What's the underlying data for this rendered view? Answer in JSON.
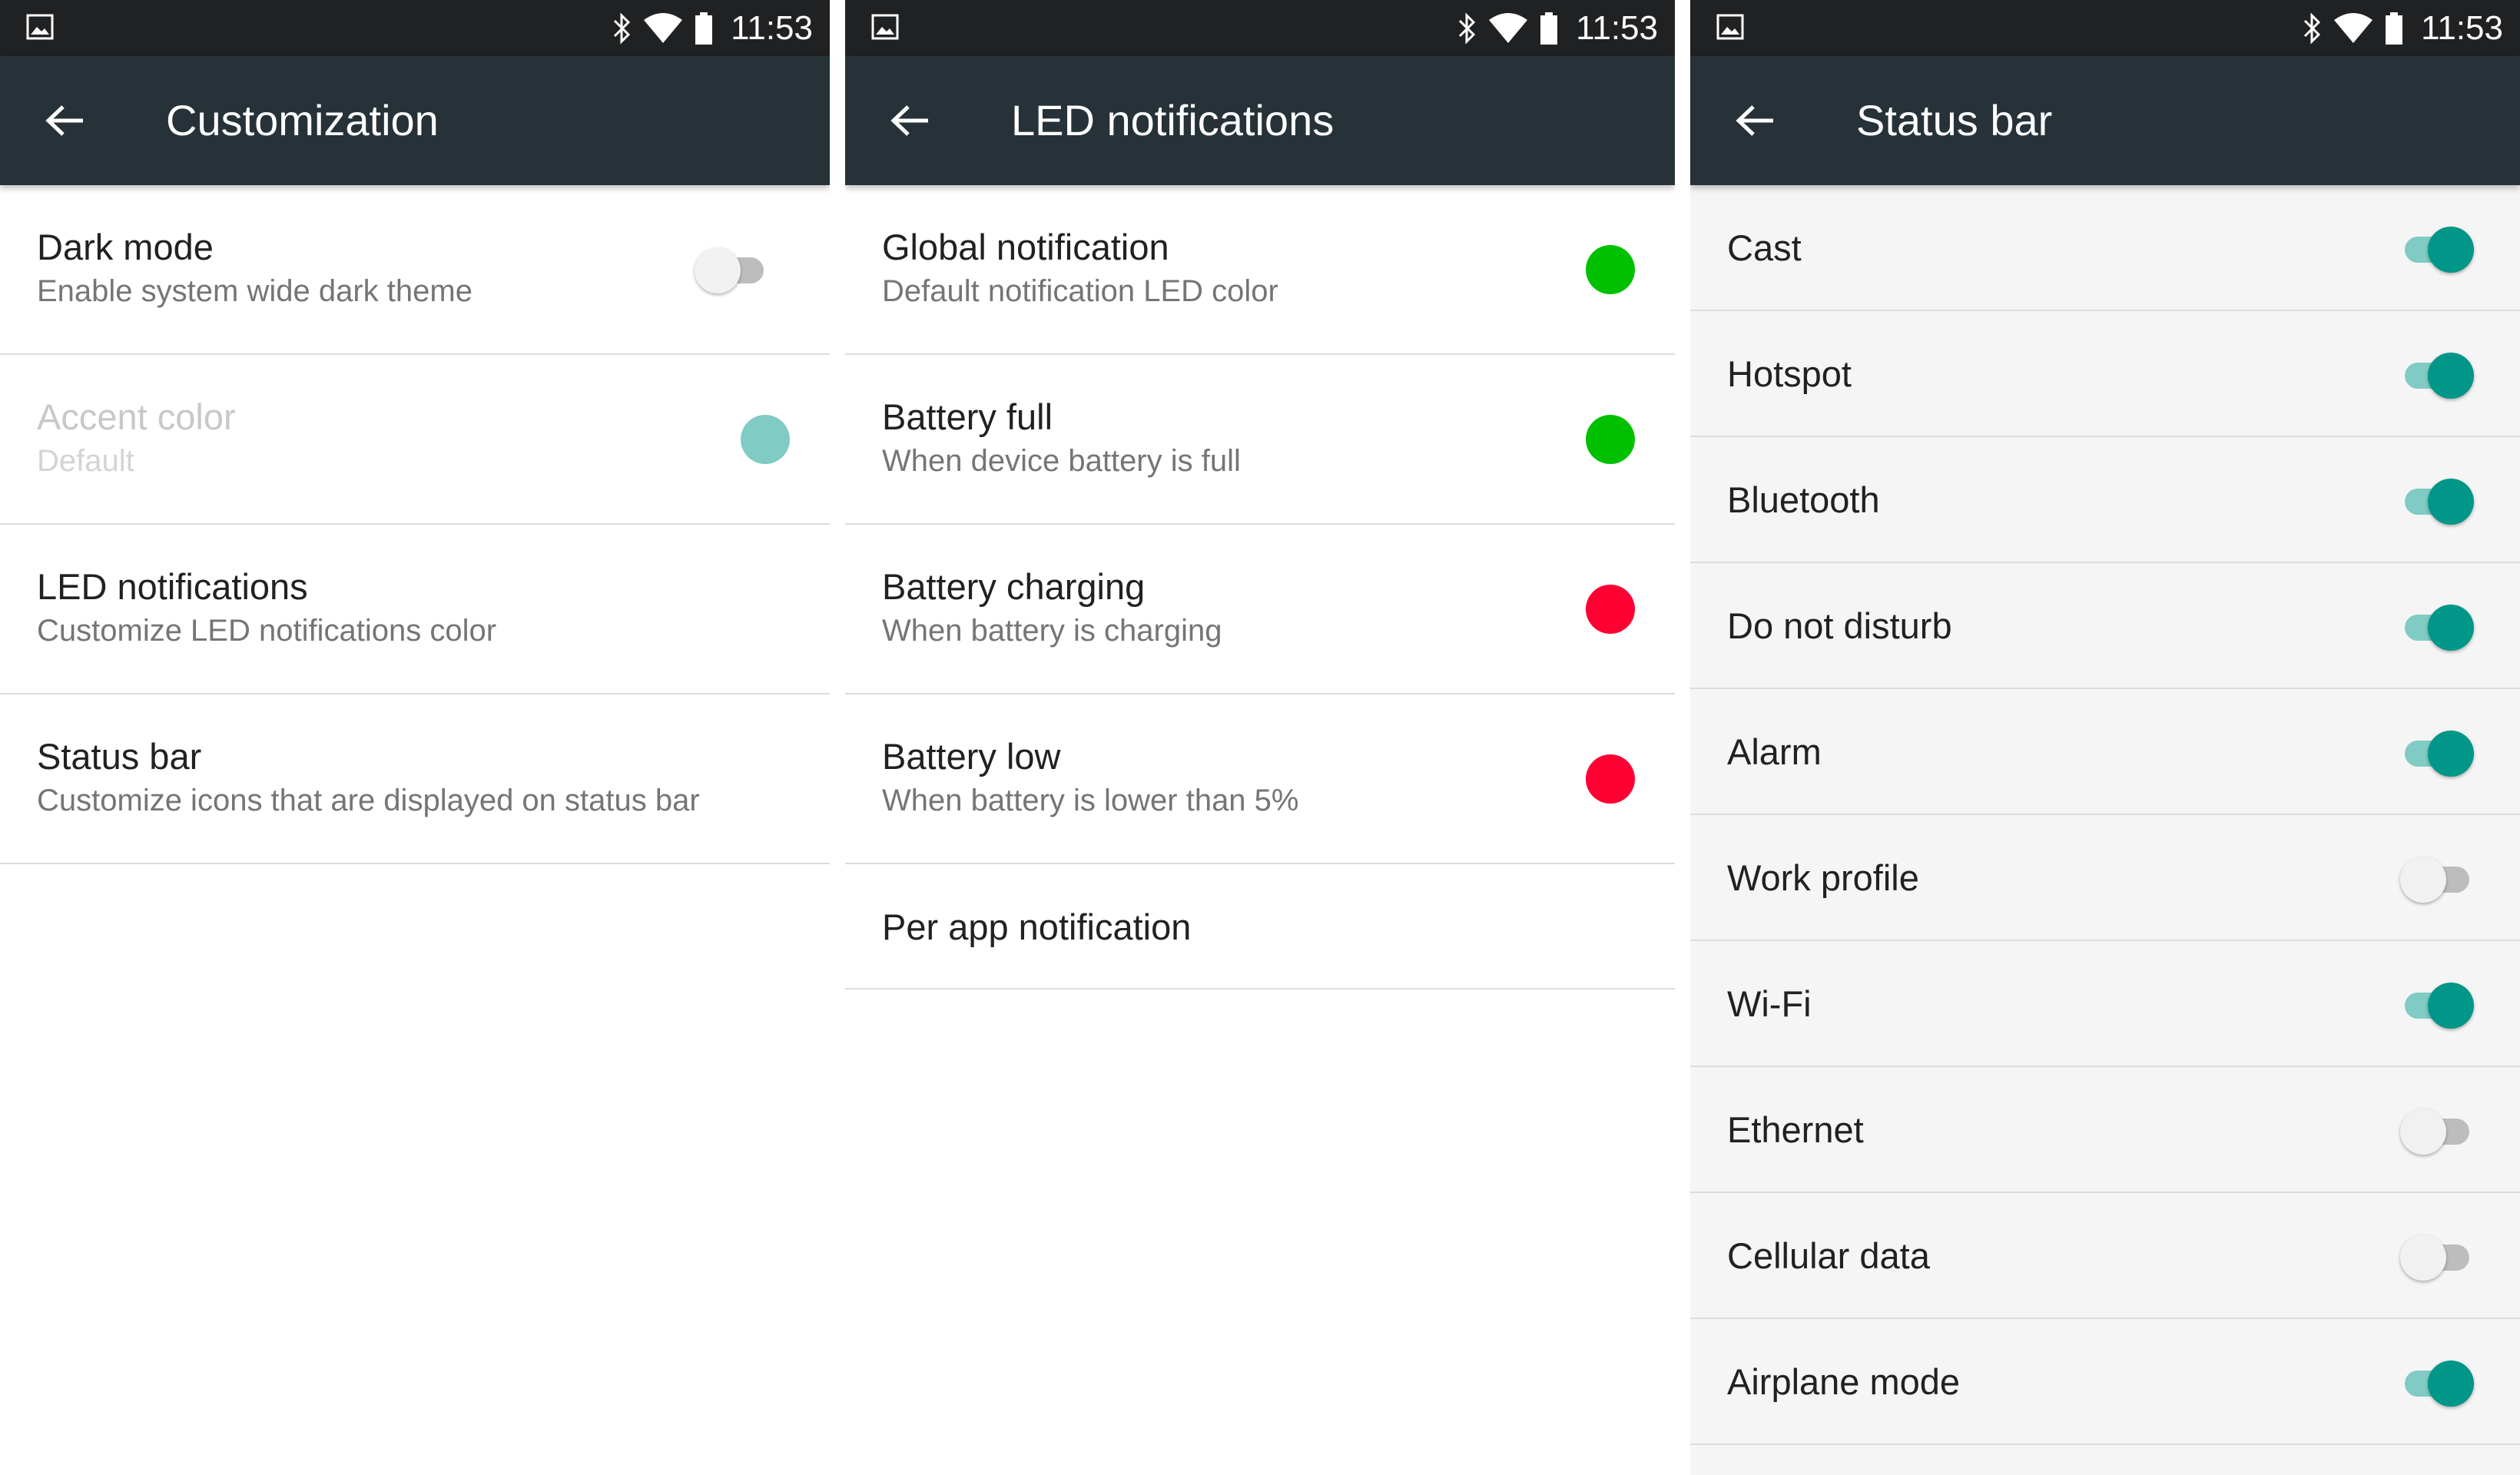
{
  "status_bar": {
    "time": "11:53",
    "icons": [
      "image-notification-icon",
      "bluetooth-icon",
      "wifi-icon",
      "battery-icon"
    ]
  },
  "colors": {
    "statusbar_bg": "#1f2123",
    "toolbar_bg": "#263238",
    "accent": "#009688",
    "accent_track": "#80cbc4",
    "led_green": "#00c000",
    "led_red": "#ff0033",
    "accent_swatch": "#80cbc4"
  },
  "screens": [
    {
      "title": "Customization",
      "items": [
        {
          "title": "Dark mode",
          "summary": "Enable system wide dark theme",
          "widget": "switch",
          "on": false
        },
        {
          "title": "Accent color",
          "summary": "Default",
          "widget": "color-dot",
          "color": "#80cbc4",
          "disabled": true
        },
        {
          "title": "LED notifications",
          "summary": "Customize LED notifications color"
        },
        {
          "title": "Status bar",
          "summary": "Customize icons that are displayed on status bar"
        }
      ]
    },
    {
      "title": "LED notifications",
      "items": [
        {
          "title": "Global notification",
          "summary": "Default notification LED color",
          "color": "#00c000"
        },
        {
          "title": "Battery full",
          "summary": "When device battery is full",
          "color": "#00c000"
        },
        {
          "title": "Battery charging",
          "summary": "When battery is charging",
          "color": "#ff0033"
        },
        {
          "title": "Battery low",
          "summary": "When battery is lower than 5%",
          "color": "#ff0033"
        },
        {
          "title": "Per app notification"
        }
      ]
    },
    {
      "title": "Status bar",
      "items": [
        {
          "title": "Cast",
          "on": true
        },
        {
          "title": "Hotspot",
          "on": true
        },
        {
          "title": "Bluetooth",
          "on": true
        },
        {
          "title": "Do not disturb",
          "on": true
        },
        {
          "title": "Alarm",
          "on": true
        },
        {
          "title": "Work profile",
          "on": false
        },
        {
          "title": "Wi-Fi",
          "on": true
        },
        {
          "title": "Ethernet",
          "on": false
        },
        {
          "title": "Cellular data",
          "on": false
        },
        {
          "title": "Airplane mode",
          "on": true
        }
      ]
    }
  ]
}
